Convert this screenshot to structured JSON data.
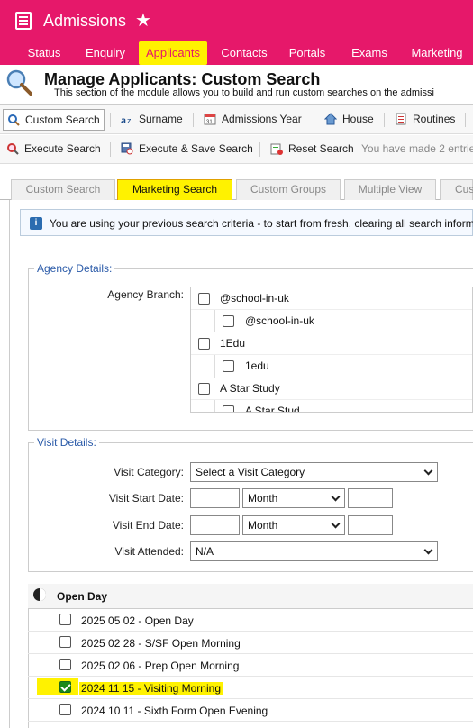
{
  "app": {
    "title": "Admissions"
  },
  "nav": [
    "Status",
    "Enquiry",
    "Applicants",
    "Contacts",
    "Portals",
    "Exams",
    "Marketing"
  ],
  "page": {
    "title": "Manage Applicants: Custom Search",
    "subtitle": "This section of the module allows you to build and run custom searches on the admissi"
  },
  "toolbar1": [
    "Custom Search",
    "Surname",
    "Admissions Year",
    "House",
    "Routines"
  ],
  "toolbar2": {
    "buttons": [
      "Execute Search",
      "Execute & Save Search",
      "Reset Search"
    ],
    "note": "You have made 2 entrie"
  },
  "tabs": [
    "Custom Search",
    "Marketing Search",
    "Custom Groups",
    "Multiple View",
    "Cus"
  ],
  "info": "You are using your previous search criteria - to start from fresh, clearing all search inform",
  "agency": {
    "legend": "Agency Details:",
    "label": "Agency Branch:",
    "items": [
      {
        "name": "@school-in-uk",
        "child": "@school-in-uk"
      },
      {
        "name": "1Edu",
        "child": "1edu"
      },
      {
        "name": "A Star Study",
        "child": "A Star Stud"
      }
    ]
  },
  "visit": {
    "legend": "Visit Details:",
    "category_label": "Visit Category:",
    "category_value": "Select a Visit Category",
    "start_label": "Visit Start Date:",
    "end_label": "Visit End Date:",
    "month": "Month",
    "attended_label": "Visit Attended:",
    "attended_value": "N/A"
  },
  "open_day": {
    "title": "Open Day",
    "items": [
      {
        "label": "2025 05 02 - Open Day",
        "checked": false
      },
      {
        "label": "2025 02 28 - S/SF Open Morning",
        "checked": false
      },
      {
        "label": "2025 02 06 - Prep Open Morning",
        "checked": false
      },
      {
        "label": "2024 11 15 - Visiting Morning",
        "checked": true
      },
      {
        "label": "2024 10 11 - Sixth Form Open Evening",
        "checked": false
      }
    ]
  },
  "colors": {
    "brand": "#e6186a",
    "highlight": "#fff200",
    "link": "#2a5aa8"
  }
}
